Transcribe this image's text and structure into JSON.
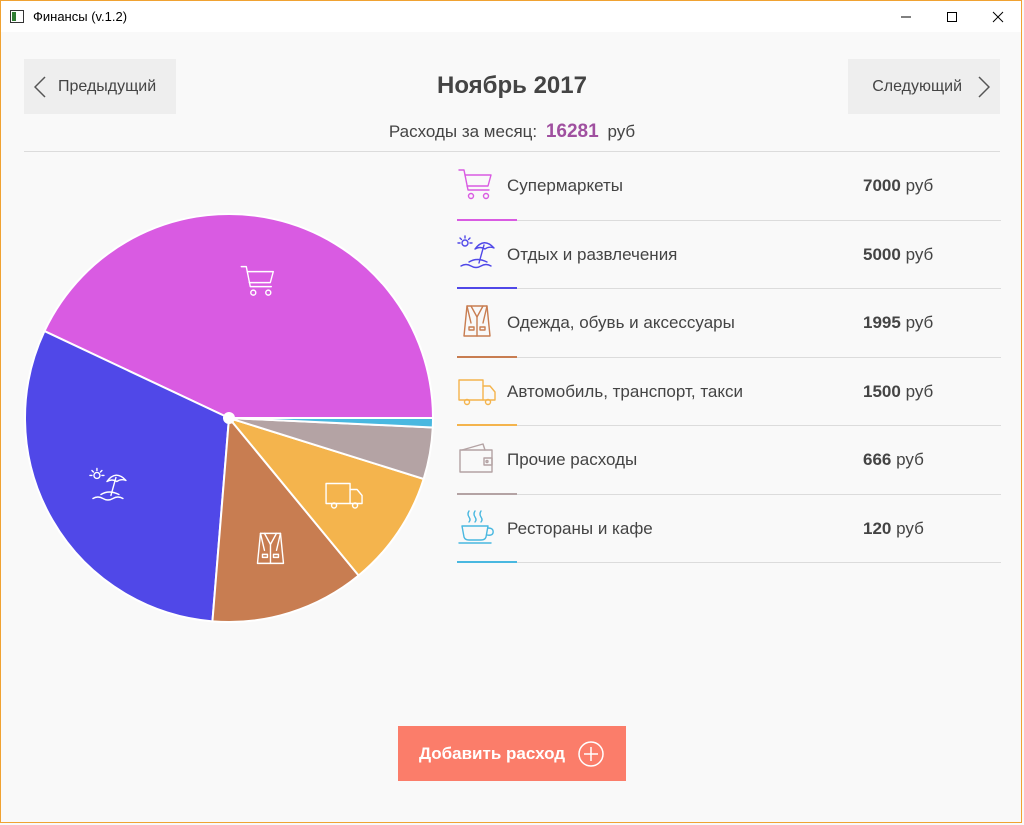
{
  "window": {
    "title": "Финансы (v.1.2)",
    "frame_color": "#f0a232"
  },
  "nav": {
    "prev_label": "Предыдущий",
    "next_label": "Следующий"
  },
  "header": {
    "month": "Ноябрь 2017",
    "summary_label": "Расходы за месяц:",
    "total": "16281",
    "currency": "руб",
    "total_color": "#a050a0"
  },
  "categories": [
    {
      "name": "Супермаркеты",
      "amount": "7000",
      "currency": "руб",
      "icon": "shopping-cart-icon",
      "color": "#d95be2"
    },
    {
      "name": "Отдых и развлечения",
      "amount": "5000",
      "currency": "руб",
      "icon": "beach-umbrella-icon",
      "color": "#5048e8"
    },
    {
      "name": "Одежда, обувь и аксессуары",
      "amount": "1995",
      "currency": "руб",
      "icon": "jacket-icon",
      "color": "#c87d51"
    },
    {
      "name": "Автомобиль, транспорт, такси",
      "amount": "1500",
      "currency": "руб",
      "icon": "truck-icon",
      "color": "#f4b44d"
    },
    {
      "name": "Прочие расходы",
      "amount": "666",
      "currency": "руб",
      "icon": "wallet-icon",
      "color": "#b4a3a4"
    },
    {
      "name": "Рестораны и кафе",
      "amount": "120",
      "currency": "руб",
      "icon": "coffee-cup-icon",
      "color": "#49b8e0"
    }
  ],
  "chart_data": {
    "type": "pie",
    "categories": [
      "Супермаркеты",
      "Отдых и развлечения",
      "Одежда, обувь и аксессуары",
      "Автомобиль, транспорт, такси",
      "Прочие расходы",
      "Рестораны и кафе"
    ],
    "values": [
      7000,
      5000,
      1995,
      1500,
      666,
      120
    ],
    "colors": [
      "#d95be2",
      "#5048e8",
      "#c87d51",
      "#f4b44d",
      "#b4a3a4",
      "#49b8e0"
    ],
    "title": "",
    "legend": "right"
  },
  "add_button": {
    "label": "Добавить расход",
    "color": "#fb7d6a"
  }
}
